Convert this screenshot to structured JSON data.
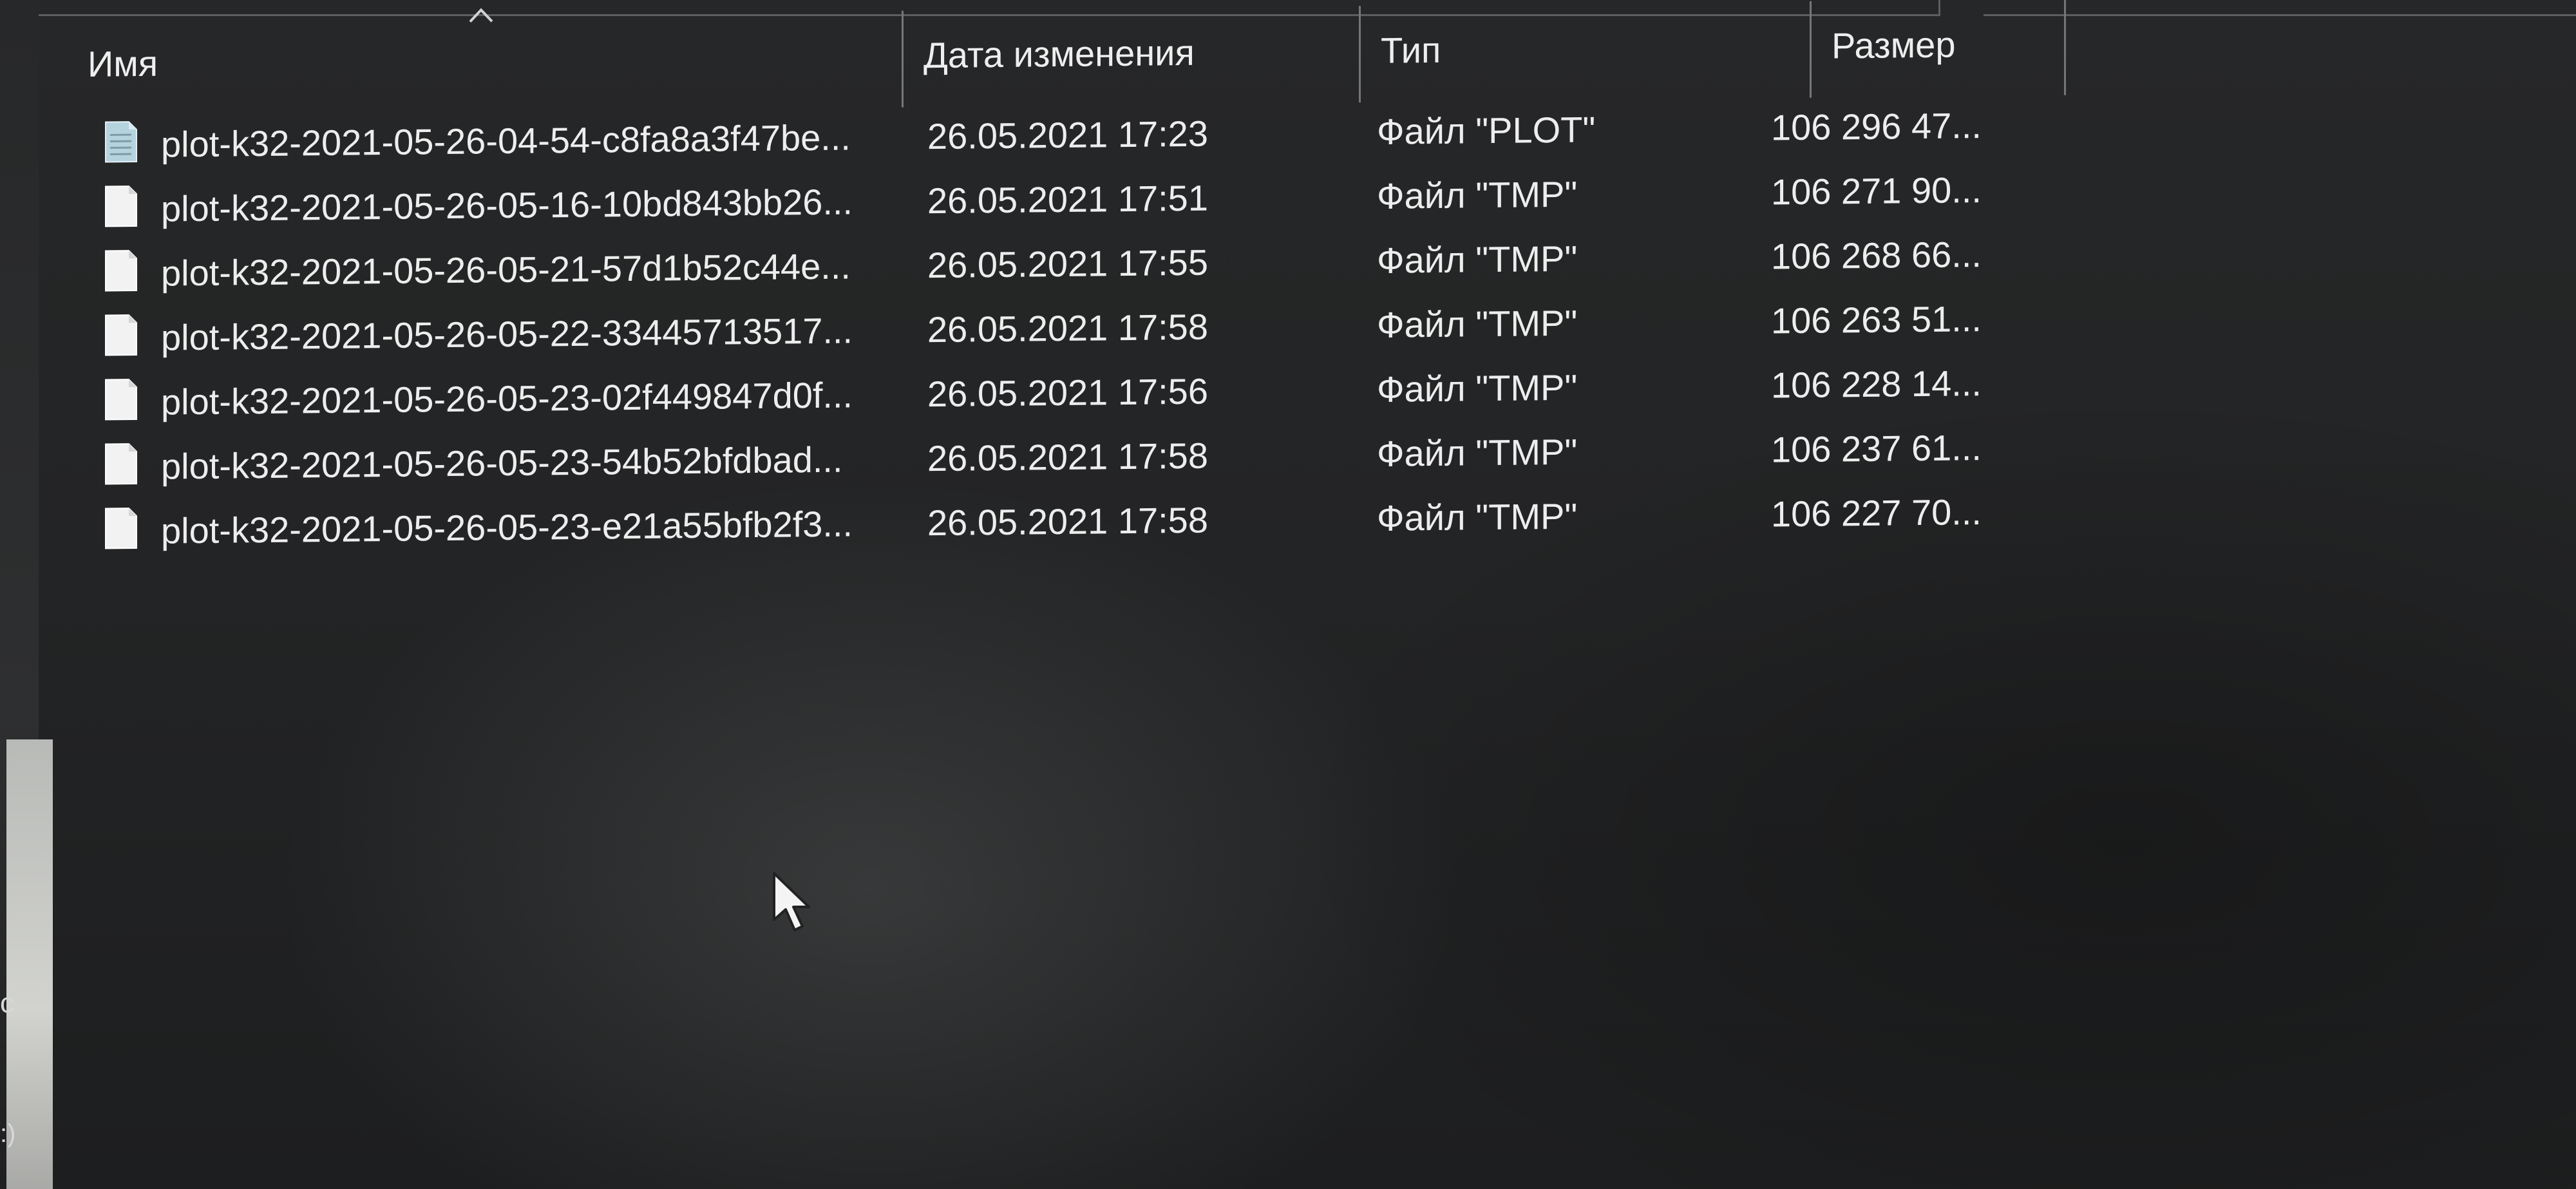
{
  "columns": {
    "name": "Имя",
    "date": "Дата изменения",
    "type": "Тип",
    "size": "Размер"
  },
  "sort": {
    "column": "name",
    "direction": "ascending",
    "icon": "chevron-up-icon"
  },
  "files": [
    {
      "name": "plot-k32-2021-05-26-04-54-c8fa8a3f47be...",
      "date": "26.05.2021 17:23",
      "type": "Файл \"PLOT\"",
      "size": "106 296 47...",
      "icon": "plot-file-icon"
    },
    {
      "name": "plot-k32-2021-05-26-05-16-10bd843bb26...",
      "date": "26.05.2021 17:51",
      "type": "Файл \"TMP\"",
      "size": "106 271 90...",
      "icon": "file-icon"
    },
    {
      "name": "plot-k32-2021-05-26-05-21-57d1b52c44e...",
      "date": "26.05.2021 17:55",
      "type": "Файл \"TMP\"",
      "size": "106 268 66...",
      "icon": "file-icon"
    },
    {
      "name": "plot-k32-2021-05-26-05-22-33445713517...",
      "date": "26.05.2021 17:58",
      "type": "Файл \"TMP\"",
      "size": "106 263 51...",
      "icon": "file-icon"
    },
    {
      "name": "plot-k32-2021-05-26-05-23-02f449847d0f...",
      "date": "26.05.2021 17:56",
      "type": "Файл \"TMP\"",
      "size": "106 228 14...",
      "icon": "file-icon"
    },
    {
      "name": "plot-k32-2021-05-26-05-23-54b52bfdbad...",
      "date": "26.05.2021 17:58",
      "type": "Файл \"TMP\"",
      "size": "106 237 61...",
      "icon": "file-icon"
    },
    {
      "name": "plot-k32-2021-05-26-05-23-e21a55bfb2f3...",
      "date": "26.05.2021 17:58",
      "type": "Файл \"TMP\"",
      "size": "106 227 70...",
      "icon": "file-icon"
    }
  ],
  "left_panel": {
    "fragment_1": "c",
    "fragment_2": ":)"
  },
  "cursor": {
    "icon": "mouse-pointer-icon"
  },
  "colors": {
    "background": "#232425",
    "text": "#ededed",
    "separator": "#74777a",
    "plot_icon": "#b5d3df"
  }
}
